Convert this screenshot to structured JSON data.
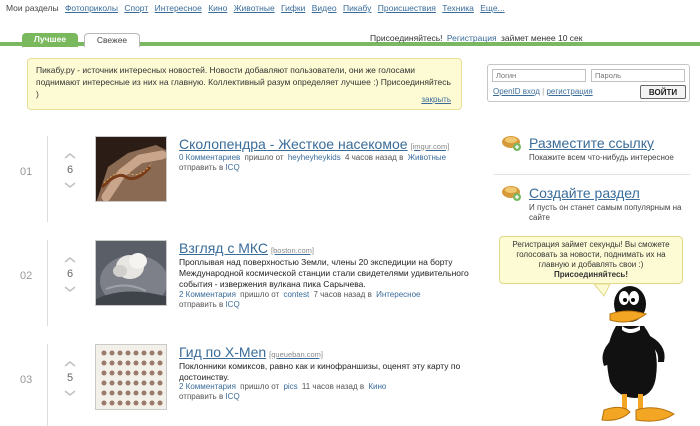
{
  "topnav": {
    "label": "Мои разделы",
    "items": [
      "Фотоприколы",
      "Спорт",
      "Интересное",
      "Кино",
      "Животные",
      "Гифки",
      "Видео",
      "Пикабу",
      "Происшествия",
      "Техника",
      "Еще..."
    ]
  },
  "tabs": {
    "best": "Лучшее",
    "fresh": "Свежее"
  },
  "join": {
    "prefix": "Присоединяйтесь!",
    "link": "Регистрация",
    "suffix": "займет менее 10 сек"
  },
  "info": {
    "text": "Пикабу.ру - источник интересных новостей. Новости добавляют пользователи, они же голосами поднимают интересные из них на главную. Коллективный разум определяет лучшее :) Присоединяйтесь )",
    "close": "закрыть"
  },
  "login": {
    "user_placeholder": "Логин",
    "pass_placeholder": "Пароль",
    "openid": "OpenID вход",
    "register": "регистрация",
    "button": "ВОЙТИ"
  },
  "posts": [
    {
      "rank": "01",
      "rating": "6",
      "title": "Сколопендра - Жесткое насекомое",
      "source": "[imgur.com]",
      "description": "",
      "comments": "0 Комментариев",
      "came": "пришло от",
      "user": "heyheyheykids",
      "time": "4 часов назад",
      "in": "в",
      "category": "Животные",
      "send": "отправить в",
      "icq": "ICQ"
    },
    {
      "rank": "02",
      "rating": "6",
      "title": "Взгляд с МКС",
      "source": "[boston.com]",
      "description": "Проплывая над поверхностью Земли, члены 20 экспедиции на борту Международной космической станции стали свидетелями удивительного события - извержения вулкана пика Сарычева.",
      "comments": "2 Комментария",
      "came": "пришло от",
      "user": "contest",
      "time": "7 часов назад",
      "in": "в",
      "category": "Интересное",
      "send": "отправить в",
      "icq": "ICQ"
    },
    {
      "rank": "03",
      "rating": "5",
      "title": "Гид по X-Men",
      "source": "[queueban.com]",
      "description": "Поклонники комиксов, равно как и кинофраншизы, оценят эту карту по достоинству.",
      "comments": "2 Комментария",
      "came": "пришло от",
      "user": "pics",
      "time": "11 часов назад",
      "in": "в",
      "category": "Кино",
      "send": "отправить в",
      "icq": "ICQ"
    }
  ],
  "side": {
    "post_link": {
      "title": "Разместите ссылку",
      "sub": "Покажите всем что-нибудь интересное"
    },
    "section": {
      "title": "Создайте раздел",
      "sub": "И пусть он станет самым популярным на сайте"
    }
  },
  "bubble": {
    "text": "Регистрация займет секунды! Вы сможете голосовать за новости, поднимать их на главную и добавлять свои :)",
    "bold": "Присоединяйтесь!"
  },
  "colors": {
    "accent_green": "#79b85d",
    "link_blue": "#3a6c9a",
    "info_bg": "#fdfbd4"
  }
}
